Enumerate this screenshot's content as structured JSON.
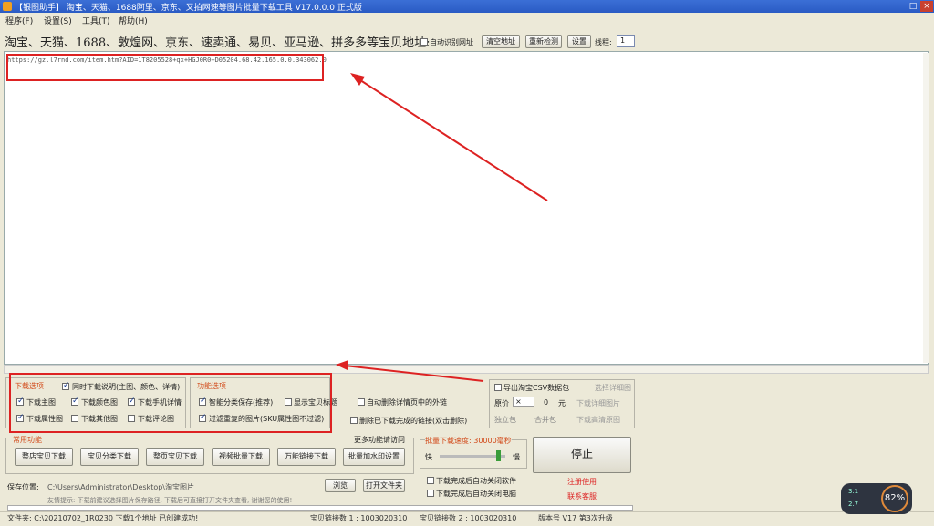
{
  "window": {
    "title": "【银图助手】 淘宝、天猫、1688阿里、京东、又拍网速等图片批量下载工具 V17.0.0.0 正式版",
    "minimize": "－",
    "maximize": "□",
    "close": "×"
  },
  "menu": [
    "程序(F)",
    "设置(S)",
    "工具(T)",
    "帮助(H)"
  ],
  "url_row": {
    "label": "淘宝、天猫、1688、敦煌网、京东、速卖通、易贝、亚马逊、拼多多等宝贝地址:",
    "auto_open_label": "自动识别网址",
    "clear_button": "清空地址",
    "reset_button": "重新检测",
    "settings_button": "设置",
    "threads_label": "线程:",
    "threads_value": "1"
  },
  "textarea": {
    "line1": "https://gz.l7rnd.com/item.htm?AID=1T8205528+qx+HGJ0R0+D05204.68.42.165.0.0.343062.0"
  },
  "download_options": {
    "title": "下载选项",
    "items": [
      {
        "label": "同时下载说明(主图、颜色、详情)",
        "checked": true
      },
      {
        "label": "下载主图",
        "checked": true
      },
      {
        "label": "下载颜色图",
        "checked": true
      },
      {
        "label": "下载手机详情",
        "checked": true
      },
      {
        "label": "下载属性图",
        "checked": true
      },
      {
        "label": "下载其他图",
        "checked": false
      },
      {
        "label": "下载评论图",
        "checked": false
      }
    ]
  },
  "func_options": {
    "title": "功能选项",
    "items": [
      {
        "label": "智能分类保存(推荐)",
        "checked": true
      },
      {
        "label": "显示宝贝标题",
        "checked": false
      },
      {
        "label": "过滤重复的图片(SKU属性图不过滤)",
        "checked": true
      }
    ]
  },
  "misc_options": [
    {
      "label": "自动删除详情页中的外链",
      "checked": false
    },
    {
      "label": "删除已下载完成的链接(双击删除)",
      "checked": false
    }
  ],
  "export": {
    "title_checkbox": "导出淘宝CSV数据包",
    "select_image": "选择详细图",
    "price_label": "原价",
    "price_op": "×",
    "price_value": "0",
    "price_unit": "元",
    "radio1": "独立包",
    "radio2": "合并包",
    "opt_download_detail": "下载详细图片",
    "opt_download_detail2": "下载高清原图"
  },
  "common_ops": {
    "title": "常用功能",
    "buttons": [
      "整店宝贝下载",
      "宝贝分类下载",
      "整页宝贝下载",
      "视频批量下载",
      "万能链接下载",
      "批量加水印设置"
    ],
    "extra_label": "更多功能请访问"
  },
  "speed": {
    "title": "批量下载速度: 30000毫秒",
    "fast": "快",
    "slow": "慢",
    "stop_button": "停止"
  },
  "save": {
    "label": "保存位置:",
    "path": "C:\\Users\\Administrator\\Desktop\\淘宝图片",
    "browse_button": "浏览",
    "open_button": "打开文件夹",
    "tip": "友情提示: 下载前建议选择图片保存路径, 下载后可直接打开文件夹查看, 谢谢您的使用!",
    "after_close_app": "下载完成后自动关闭软件",
    "after_shutdown": "下载完成后自动关闭电脑",
    "link_register": "注册使用",
    "link_contact": "联系客服"
  },
  "status": {
    "file": "文件夹: C:\\20210702_1R0230 下载1个地址 已创建成功!",
    "s1": "宝贝链接数 1 : 1003020310",
    "s2": "宝贝链接数 2 : 1003020310",
    "s3": "版本号 V17 第3次升级"
  },
  "gauge": {
    "value": "82%",
    "up": "3.1",
    "down": "2.7"
  },
  "colors": {
    "titlebar": "#2a5bc4",
    "accent_red": "#dd2222",
    "background": "#ece9d8"
  }
}
